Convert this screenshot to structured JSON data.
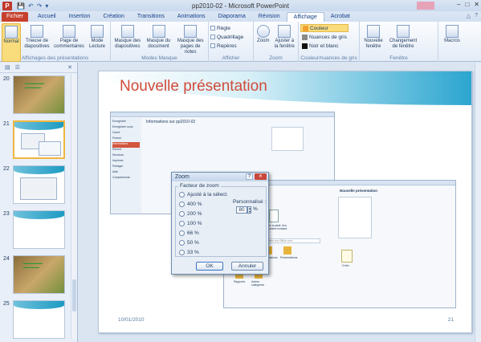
{
  "window": {
    "title": "pp2010-02 - Microsoft PowerPoint",
    "app_badge": "P",
    "qat_icons": [
      "save-icon",
      "undo-icon",
      "redo-icon",
      "customize-icon"
    ],
    "controls": [
      "‒",
      "□",
      "✕"
    ]
  },
  "ribbon_tabs": [
    {
      "label": "Fichier",
      "active": false,
      "file": true
    },
    {
      "label": "Accueil",
      "active": false
    },
    {
      "label": "Insertion",
      "active": false
    },
    {
      "label": "Création",
      "active": false
    },
    {
      "label": "Transitions",
      "active": false
    },
    {
      "label": "Animations",
      "active": false
    },
    {
      "label": "Diaporama",
      "active": false
    },
    {
      "label": "Révision",
      "active": false
    },
    {
      "label": "Affichage",
      "active": true
    },
    {
      "label": "Acrobat",
      "active": false
    }
  ],
  "ribbon": {
    "g1": {
      "label": "Affichages des présentations",
      "buttons": [
        "Normal",
        "Trieuse de diapositives",
        "Page de commentaires",
        "Mode Lecture"
      ]
    },
    "g2": {
      "label": "Modes Masque",
      "buttons": [
        "Masque des diapositives",
        "Masque du document",
        "Masque des pages de notes"
      ]
    },
    "g3": {
      "label": "Afficher",
      "checks": [
        "Règle",
        "Quadrillage",
        "Repères"
      ]
    },
    "g4": {
      "label": "Zoom",
      "buttons": [
        "Zoom",
        "Ajuster à la fenêtre"
      ]
    },
    "g5": {
      "label": "Couleur/nuances de gris",
      "options": [
        "Couleur",
        "Nuances de gris",
        "Noir et blanc"
      ],
      "colors": [
        "#f0a030",
        "#8a8a8a",
        "#111111"
      ]
    },
    "g6": {
      "label": "Fenêtre",
      "buttons": [
        "Nouvelle fenêtre",
        "Changement de fenêtre",
        "Macros"
      ]
    }
  },
  "panel": {
    "slide_numbers": [
      "20",
      "21",
      "22",
      "23",
      "24",
      "25"
    ],
    "selected": "21"
  },
  "slide": {
    "title": "Nouvelle présentation",
    "date": "10/01/2010",
    "number": "21"
  },
  "backstage1": {
    "heading": "Informations sur pp2010-02",
    "menu": [
      "Enregistrer",
      "Enregistrer sous",
      "Ouvrir",
      "Fermer",
      "Informations",
      "Récent",
      "Nouveau",
      "Imprimer",
      "Partager",
      "Aide",
      "Compléments",
      "Options",
      "Quitter"
    ]
  },
  "backstage2": {
    "heading": "Nouvelle présentation",
    "search_placeholder": "Rechercher des modèles sur Office.com",
    "tiles": [
      "Mes modèles",
      "Créer à partir d'un document existant",
      "Diapositives de conception",
      "Planifications",
      "Présentations",
      "Rapports",
      "Autres catégories"
    ],
    "create_label": "Créer",
    "bottom_menu": [
      "Options",
      "Quitter"
    ]
  },
  "zoom_dialog": {
    "title": "Zoom",
    "help": "?",
    "close": "✕",
    "legend": "Facteur de zoom",
    "options": [
      "Ajusté à la sélect.",
      "400 %",
      "200 %",
      "100 %",
      "66 %",
      "50 %",
      "33 %"
    ],
    "custom_label": "Personnalisé :",
    "custom_value": "80",
    "percent": "%",
    "ok": "OK",
    "cancel": "Annuler"
  }
}
